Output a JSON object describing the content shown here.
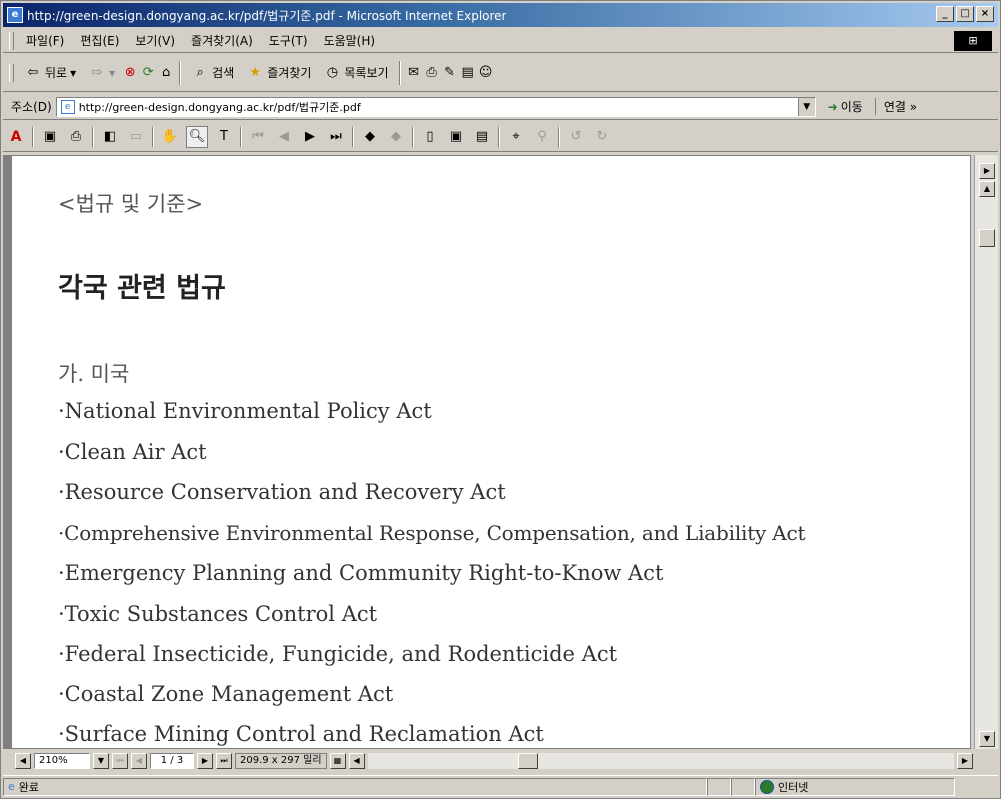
{
  "window": {
    "title": "http://green-design.dongyang.ac.kr/pdf/법규기준.pdf - Microsoft Internet Explorer",
    "controls": {
      "minimize": "_",
      "maximize": "□",
      "close": "×"
    }
  },
  "menu": {
    "items": [
      "파일(F)",
      "편집(E)",
      "보기(V)",
      "즐겨찾기(A)",
      "도구(T)",
      "도움말(H)"
    ]
  },
  "toolbar": {
    "back_label": "뒤로",
    "search_label": "검색",
    "favorites_label": "즐겨찾기",
    "history_label": "목록보기"
  },
  "address": {
    "label": "주소(D)",
    "url": "http://green-design.dongyang.ac.kr/pdf/법규기준.pdf",
    "go_label": "이동",
    "links_label": "연결 »"
  },
  "document": {
    "header": "<법규 및 기준>",
    "title": "각국 관련 법규",
    "section": "가. 미국",
    "items": [
      "·National Environmental Policy Act",
      "·Clean Air Act",
      "·Resource Conservation and Recovery Act",
      "·Comprehensive Environmental Response, Compensation, and Liability Act",
      "·Emergency Planning and Community Right-to-Know Act",
      "·Toxic Substances Control Act",
      "·Federal Insecticide, Fungicide, and Rodenticide Act",
      "·Coastal Zone Management Act",
      "·Surface Mining Control and Reclamation Act"
    ]
  },
  "pdf_status": {
    "zoom": "210%",
    "page": "1 / 3",
    "page_size": "209.9 x 297 밀리"
  },
  "status": {
    "text": "완료",
    "zone": "인터넷"
  }
}
